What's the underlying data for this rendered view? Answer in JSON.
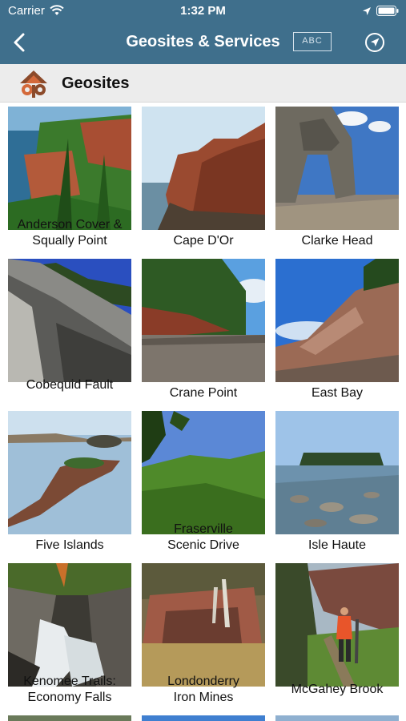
{
  "status_bar": {
    "carrier": "Carrier",
    "time": "1:32 PM"
  },
  "nav": {
    "title": "Geosites & Services",
    "abc_label": "ABC"
  },
  "section": {
    "title": "Geosites"
  },
  "sites": [
    {
      "label": "Anderson Cover & Squally Point",
      "line1": "Anderson Cover &",
      "line2": "Squally Point",
      "scene": "cliff-sea-trees"
    },
    {
      "label": "Cape D'Or",
      "line1": "Cape D'Or",
      "line2": "",
      "scene": "red-cliff-sea"
    },
    {
      "label": "Clarke  Head",
      "line1": "Clarke  Head",
      "line2": "",
      "scene": "rock-arch"
    },
    {
      "label": "Cobequid Fault",
      "line1": "Cobequid Fault",
      "line2": "",
      "scene": "grey-rock-face"
    },
    {
      "label": "Crane Point",
      "line1": "Crane Point",
      "line2": "",
      "scene": "forest-beach"
    },
    {
      "label": "East Bay",
      "line1": "East Bay",
      "line2": "",
      "scene": "slope-cliff"
    },
    {
      "label": "Five Islands",
      "line1": "Five Islands",
      "line2": "",
      "scene": "islands-water"
    },
    {
      "label": "Fraserville Scenic Drive",
      "line1": "Fraserville",
      "line2": "Scenic Drive",
      "scene": "green-valley"
    },
    {
      "label": "Isle Haute",
      "line1": "Isle Haute",
      "line2": "",
      "scene": "island-rocks"
    },
    {
      "label": "Kenomee Trails: Economy Falls",
      "line1": "Kenomee Trails:",
      "line2": "Economy Falls",
      "scene": "waterfall"
    },
    {
      "label": "Londonderry Iron Mines",
      "line1": "Londonderry",
      "line2": "Iron Mines",
      "scene": "mine-ruins"
    },
    {
      "label": "McGahey Brook",
      "line1": "McGahey Brook",
      "line2": "",
      "scene": "hiker-trail"
    }
  ],
  "colors": {
    "nav_background": "#3f6f8c",
    "section_background": "#ececec",
    "logo_brown": "#8c4a2a",
    "logo_orange": "#d4693a"
  },
  "icons": {
    "back": "chevron-left-icon",
    "abc": "text-size-icon",
    "compass": "compass-icon",
    "logo": "geopark-logo-icon"
  }
}
